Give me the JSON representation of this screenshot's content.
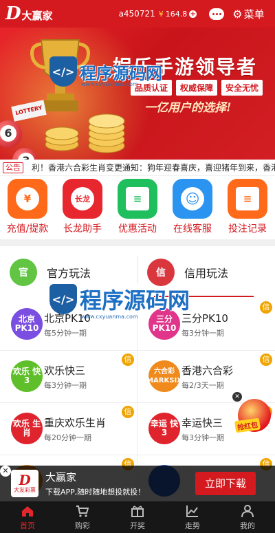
{
  "header": {
    "logo_mark": "D",
    "logo_text": "大赢家",
    "username": "a450721",
    "currency_symbol": "¥",
    "balance": "164.8",
    "menu_label": "菜单",
    "icons": [
      "chat-icon",
      "gear-icon",
      "plus-icon"
    ],
    "color": "#d4191f"
  },
  "banner": {
    "title": "娱乐手游领导者",
    "tags": [
      "品质认证",
      "权威保障",
      "安全无忧"
    ],
    "slogan": "一亿用户的选择!",
    "lottery_tag": "LOTTERY",
    "ball_numbers": [
      "6",
      "3"
    ]
  },
  "notice": {
    "tag": "公告",
    "text": "利！香港六合彩生肖变更通知：狗年迎春喜庆，喜迎猪年到来，香港六合彩"
  },
  "quick_menu": [
    {
      "label": "充值/提款",
      "icon": "yen-icon",
      "glyph": "¥",
      "color": "#ff6a1a"
    },
    {
      "label": "长龙助手",
      "icon": "dragon-icon",
      "glyph": "长龙",
      "color": "#e8262e"
    },
    {
      "label": "优惠活动",
      "icon": "document-icon",
      "glyph": "≡",
      "color": "#1fbf5e"
    },
    {
      "label": "在线客服",
      "icon": "support-agent-icon",
      "glyph": "☺",
      "color": "#2b93f0"
    },
    {
      "label": "投注记录",
      "icon": "record-icon",
      "glyph": "≡",
      "color": "#ff6a1a"
    }
  ],
  "play_tabs": [
    {
      "label": "官方玩法",
      "badge": "官",
      "color": "#62c443",
      "active": false
    },
    {
      "label": "信用玩法",
      "badge": "信",
      "color": "#d9363e",
      "active": true
    }
  ],
  "games": [
    {
      "name": "北京PK10",
      "desc": "每5分钟一期",
      "logo": "北京 PK10",
      "color": "#7a4ee0",
      "tag": "信"
    },
    {
      "name": "三分PK10",
      "desc": "每3分钟一期",
      "logo": "三分 PK10",
      "color": "#e0358a",
      "tag": "信"
    },
    {
      "name": "欢乐快三",
      "desc": "每3分钟一期",
      "logo": "欢乐 快3",
      "color": "#5fbf2a",
      "tag": "信"
    },
    {
      "name": "香港六合彩",
      "desc": "每2/3天一期",
      "logo": "六合彩 MARKSIX",
      "color": "#f08a1c",
      "tag": "信"
    },
    {
      "name": "重庆欢乐生肖",
      "desc": "每20分钟一期",
      "logo": "欢乐 生肖",
      "color": "#e0242d",
      "tag": "信"
    },
    {
      "name": "幸运快三",
      "desc": "每3分钟一期",
      "logo": "幸运 快3",
      "color": "#e0242d",
      "tag": "信"
    },
    {
      "name": "",
      "desc": "",
      "logo": "",
      "color": "#f08a1c",
      "tag": "信"
    },
    {
      "name": "",
      "desc": "",
      "logo": "",
      "color": "#2a62c8",
      "tag": "信"
    }
  ],
  "download_bar": {
    "close": "✕",
    "logo_mark": "D",
    "logo_sub": "大友彩票",
    "title": "大赢家",
    "subtitle": "下载APP,随时随地想投就投！",
    "button": "立即下载"
  },
  "gift": {
    "close": "✕",
    "label": "抢红包"
  },
  "tabbar": [
    {
      "label": "首页",
      "icon": "home-icon",
      "active": true
    },
    {
      "label": "购彩",
      "icon": "cart-icon",
      "active": false
    },
    {
      "label": "开奖",
      "icon": "gift-icon",
      "active": false
    },
    {
      "label": "走势",
      "icon": "trend-icon",
      "active": false
    },
    {
      "label": "我的",
      "icon": "user-icon",
      "active": false
    }
  ],
  "watermark": {
    "text": "程序源码网",
    "url": "www.cxyuanma.com",
    "mark": "</>"
  }
}
